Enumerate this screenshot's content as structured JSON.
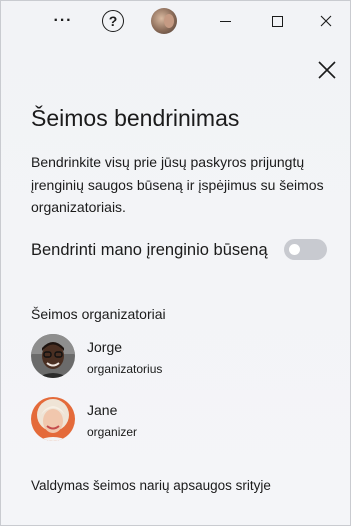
{
  "titlebar": {
    "more_label": "···",
    "help_label": "?",
    "icons": [
      "more-icon",
      "help-icon",
      "account-avatar",
      "minimize-icon",
      "maximize-icon",
      "close-icon"
    ]
  },
  "pane": {
    "title": "Šeimos bendrinimas",
    "description": "Bendrinkite visų prie jūsų paskyros prijungtų įrenginių saugos būseną ir įspėjimus su šeimos organizatoriais.",
    "toggle": {
      "label": "Bendrinti mano įrenginio būseną",
      "state": "off"
    },
    "section_title": "Šeimos organizatoriai",
    "members": [
      {
        "name": "Jorge",
        "role": "organizatorius"
      },
      {
        "name": "Jane",
        "role": "organizer"
      }
    ],
    "footer_link": "Valdymas šeimos narių apsaugos srityje"
  },
  "colors": {
    "background": "#f3f4f7",
    "toggle_off": "#c8cad0",
    "text": "#1b1b1b"
  }
}
